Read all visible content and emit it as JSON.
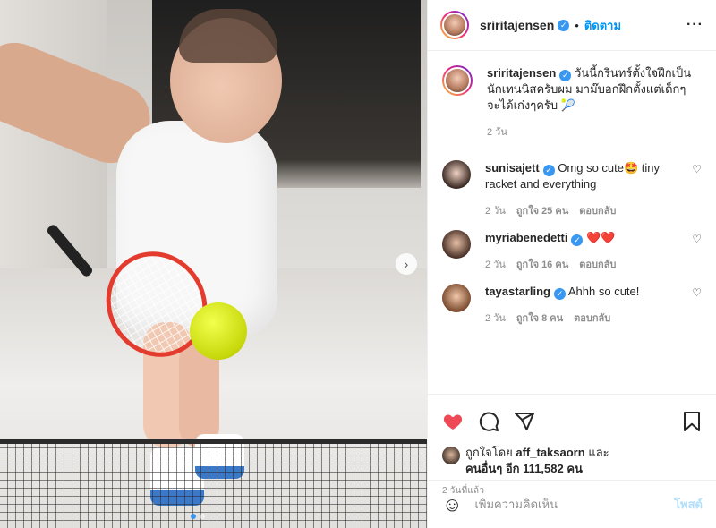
{
  "header": {
    "username": "sriritajensen",
    "follow_label": "ติดตาม",
    "more_label": "···"
  },
  "caption": {
    "username": "sriritajensen",
    "text": "วันนี้กรินทร์ตั้งใจฝึกเป็นนักเทนนิสครับผม มาม๊บอกฝึกตั้งแต่เด็กๆ จะได้เก่งๆครับ 🎾",
    "time": "2 วัน"
  },
  "comments": [
    {
      "username": "sunisajett",
      "text": "Omg so cute🤩 tiny racket and everything",
      "time": "2 วัน",
      "likes": "ถูกใจ 25 คน",
      "reply": "ตอบกลับ"
    },
    {
      "username": "myriabenedetti",
      "text": "❤️❤️",
      "time": "2 วัน",
      "likes": "ถูกใจ 16 คน",
      "reply": "ตอบกลับ"
    },
    {
      "username": "tayastarling",
      "text": "Ahhh so cute!",
      "time": "2 วัน",
      "likes": "ถูกใจ 8 คน",
      "reply": "ตอบกลับ"
    }
  ],
  "likes": {
    "prefix": "ถูกใจโดย",
    "user": "aff_taksaorn",
    "and": "และ",
    "others": "คนอื่นๆ อีก 111,582 คน"
  },
  "timestamp": "2 วันที่แล้ว",
  "add_comment": {
    "placeholder": "เพิ่มความคิดเห็น",
    "post_label": "โพสต์"
  },
  "carousel": {
    "current": 1,
    "total": 2
  },
  "colors": {
    "accent": "#0095f6",
    "like_red": "#ed4956",
    "muted": "#8e8e8e"
  },
  "icons": [
    "heart-icon",
    "comment-icon",
    "share-icon",
    "bookmark-icon",
    "emoji-icon",
    "chevron-right-icon",
    "verified-badge-icon"
  ]
}
